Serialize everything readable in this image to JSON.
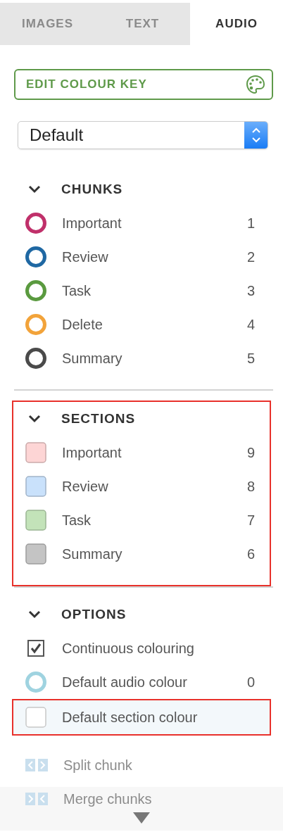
{
  "tabs": [
    {
      "label": "IMAGES",
      "selected": false
    },
    {
      "label": "TEXT",
      "selected": false
    },
    {
      "label": "AUDIO",
      "selected": true
    }
  ],
  "edit_button": {
    "label": "EDIT COLOUR KEY"
  },
  "preset_select": {
    "value": "Default"
  },
  "groups": [
    {
      "title": "CHUNKS",
      "expanded": true,
      "highlighted": false,
      "items": [
        {
          "kind": "ring",
          "label": "Important",
          "count": "1",
          "color": "#c0306a",
          "highlighted": false
        },
        {
          "kind": "ring",
          "label": "Review",
          "count": "2",
          "color": "#1f68a3",
          "highlighted": false
        },
        {
          "kind": "ring",
          "label": "Task",
          "count": "3",
          "color": "#5a9a3f",
          "highlighted": false
        },
        {
          "kind": "ring",
          "label": "Delete",
          "count": "4",
          "color": "#f2a33a",
          "highlighted": false
        },
        {
          "kind": "ring",
          "label": "Summary",
          "count": "5",
          "color": "#4a4a4a",
          "highlighted": false
        }
      ]
    },
    {
      "title": "SECTIONS",
      "expanded": true,
      "highlighted": true,
      "items": [
        {
          "kind": "swatch",
          "label": "Important",
          "count": "9",
          "color": "#fdd5d5",
          "highlighted": false
        },
        {
          "kind": "swatch",
          "label": "Review",
          "count": "8",
          "color": "#c9e1fb",
          "highlighted": false
        },
        {
          "kind": "swatch",
          "label": "Task",
          "count": "7",
          "color": "#c3e3b9",
          "highlighted": false
        },
        {
          "kind": "swatch",
          "label": "Summary",
          "count": "6",
          "color": "#c4c4c4",
          "highlighted": false
        }
      ]
    },
    {
      "title": "OPTIONS",
      "expanded": true,
      "highlighted": false,
      "items": [
        {
          "kind": "checkbox",
          "label": "Continuous colouring",
          "checked": true,
          "highlighted": false
        },
        {
          "kind": "ring",
          "label": "Default audio colour",
          "count": "0",
          "color": "#9fd3e0",
          "highlighted": false
        },
        {
          "kind": "swatch",
          "label": "Default section colour",
          "color": "#ffffff",
          "highlighted": true
        }
      ]
    }
  ],
  "actions": [
    {
      "kind": "split",
      "label": "Split chunk",
      "disabled": true
    },
    {
      "kind": "merge",
      "label": "Merge chunks",
      "disabled": true
    }
  ]
}
